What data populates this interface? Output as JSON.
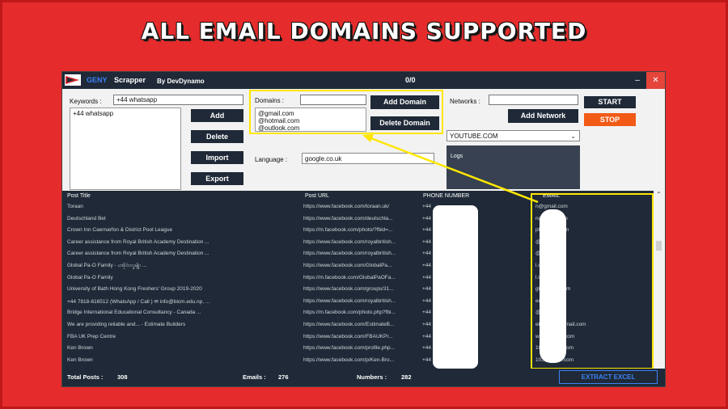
{
  "banner": {
    "headline": "ALL EMAIL DOMAINS SUPPORTED"
  },
  "window": {
    "app_name_1": "GENY",
    "app_name_2": "Scrapper",
    "author": "By DevDynamo",
    "counter": "0/0",
    "minimize": "–",
    "close": "✕"
  },
  "keywords": {
    "label": "Keywords :",
    "value": "+44 whatsapp",
    "items": [
      "+44 whatsapp"
    ],
    "add_label": "Add",
    "delete_label": "Delete",
    "import_label": "Import",
    "export_label": "Export"
  },
  "domains": {
    "label": "Domains :",
    "value": "",
    "items": [
      "@gmail.com",
      "@hotmail.com",
      "@outlook.com"
    ],
    "add_label": "Add Domain",
    "delete_label": "Delete Domain"
  },
  "language": {
    "label": "Language :",
    "selected": "google.co.uk"
  },
  "networks": {
    "label": "Networks :",
    "value": "",
    "add_label": "Add Network",
    "selected": "YOUTUBE.COM"
  },
  "controls": {
    "start_label": "START",
    "stop_label": "STOP"
  },
  "logs": {
    "label": "Logs"
  },
  "table": {
    "headers": [
      "Post Title",
      "Post URL",
      "PHONE NUMBER",
      "EMAIL"
    ],
    "rows": [
      {
        "title": "Toraan",
        "url": "https://www.facebook.com/toraan.uk/",
        "phone": "+44",
        "email": "n@gmail.com"
      },
      {
        "title": "Deutschland Bet",
        "url": "https://www.facebook.com/deutschla...",
        "phone": "+44",
        "email": "n@gmail.com"
      },
      {
        "title": "Crown Inn Caernarfon & District Pool League",
        "url": "https://m.facebook.com/photo/?fbid=...",
        "phone": "+44",
        "email": "pl@gmail.com"
      },
      {
        "title": "Career assistance from Royal British Academy Destination ...",
        "url": "https://www.facebook.com/royalbritish...",
        "phone": "+44",
        "email": "@gmail.com"
      },
      {
        "title": "Career assistance from Royal British Academy Destination ...",
        "url": "https://www.facebook.com/royalbritish...",
        "phone": "+44",
        "email": "@gmail.com"
      },
      {
        "title": "Global Pa-O Family - ပအိုဝ်းလူမျိုး ...",
        "url": "https://www.facebook.com/GlobalPa...",
        "phone": "+44",
        "email": "l.com"
      },
      {
        "title": "Global Pa-O Family",
        "url": "https://m.facebook.com/GlobalPaOFa...",
        "phone": "+44",
        "email": "l.com"
      },
      {
        "title": "University of Bath Hong Kong Freshers' Group 2019-2020",
        "url": "https://www.facebook.com/groups/31...",
        "phone": "+44",
        "email": "gh@gmail.com"
      },
      {
        "title": "+44 7818-616512 (WhatsApp / Call ) ✉ info@bicm.edu.np, ...",
        "url": "https://www.facebook.com/royalbritish...",
        "phone": "+44",
        "email": "edu.np"
      },
      {
        "title": "Bridge International Educational Consultancy - Canada ...",
        "url": "https://m.facebook.com/photo.php?fbi...",
        "phone": "+44",
        "email": "@gmail.com"
      },
      {
        "title": "We are providing reliable and... - Estimate Builders",
        "url": "https://www.facebook.com/EstimateB...",
        "phone": "+44",
        "email": "ebuilders@gmail.com"
      },
      {
        "title": "FBA UK Prep Centre",
        "url": "https://www.facebook.com/FBAUKPr...",
        "phone": "+44",
        "email": "web@gmail.com"
      },
      {
        "title": "Ken Brown",
        "url": "https://www.facebook.com/profile.php...",
        "phone": "+44",
        "email": "103@gmail.com"
      },
      {
        "title": "Ken Brown",
        "url": "https://www.facebook.com/p/Ken-Bro...",
        "phone": "+44",
        "email": "103@gmail.com"
      }
    ]
  },
  "footer": {
    "posts_label": "Total Posts :",
    "posts_value": "308",
    "emails_label": "Emails :",
    "emails_value": "276",
    "numbers_label": "Numbers :",
    "numbers_value": "282",
    "export_label": "EXTRACT EXCEL"
  },
  "colors": {
    "background": "#e52b2b",
    "window_dark": "#1f2937",
    "highlight": "#ffe600",
    "stop": "#f25a16",
    "accent": "#3b82f6"
  }
}
